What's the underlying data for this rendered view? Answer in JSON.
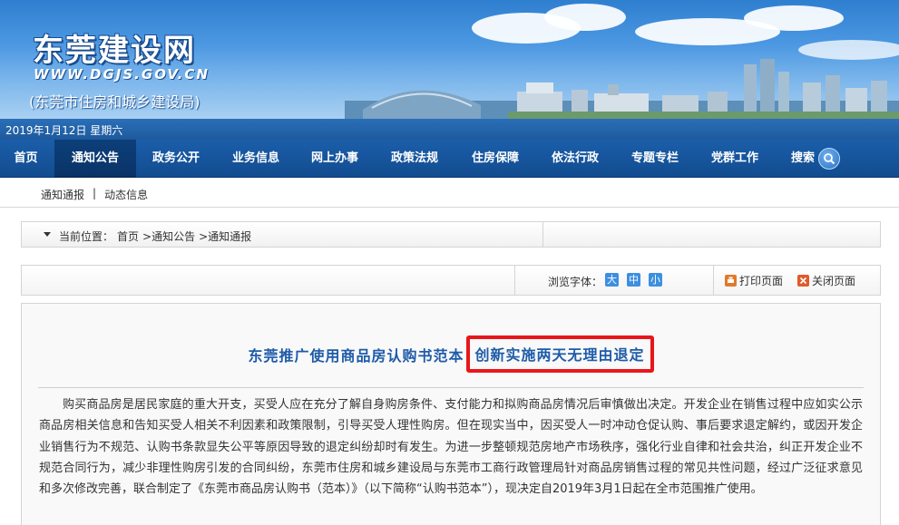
{
  "header": {
    "site_title": "东莞建设网",
    "site_url": "WWW.DGJS.GOV.CN",
    "site_sub": "(东莞市住房和城乡建设局)",
    "date": "2019年1月12日  星期六"
  },
  "nav": {
    "items": [
      {
        "label": "首页"
      },
      {
        "label": "通知公告"
      },
      {
        "label": "政务公开"
      },
      {
        "label": "业务信息"
      },
      {
        "label": "网上办事"
      },
      {
        "label": "政策法规"
      },
      {
        "label": "住房保障"
      },
      {
        "label": "依法行政"
      },
      {
        "label": "专题专栏"
      },
      {
        "label": "党群工作"
      }
    ],
    "search_label": "搜索",
    "active": "通知公告"
  },
  "subnav": {
    "items": [
      "通知通报",
      "动态信息"
    ],
    "separator": "|"
  },
  "breadcrumb": {
    "label": "当前位置：",
    "items": [
      "首页",
      ">通知公告",
      ">通知通报"
    ]
  },
  "tools": {
    "font_label": "浏览字体：",
    "font_large": "大",
    "font_medium": "中",
    "font_small": "小",
    "print_label": "打印页面",
    "close_label": "关闭页面"
  },
  "article": {
    "title_part1": "东莞推广使用商品房认购书范本",
    "title_part2": "创新实施两天无理由退定",
    "highlight_color": "#e8161b",
    "body": "购买商品房是居民家庭的重大开支，买受人应在充分了解自身购房条件、支付能力和拟购商品房情况后审慎做出决定。开发企业在销售过程中应如实公示商品房相关信息和告知买受人相关不利因素和政策限制，引导买受人理性购房。但在现实当中，因买受人一时冲动仓促认购、事后要求退定解约，或因开发企业销售行为不规范、认购书条款显失公平等原因导致的退定纠纷却时有发生。为进一步整顿规范房地产市场秩序，强化行业自律和社会共治，纠正开发企业不规范合同行为，减少非理性购房引发的合同纠纷，东莞市住房和城乡建设局与东莞市工商行政管理局针对商品房销售过程的常见共性问题，经过广泛征求意见和多次修改完善，联合制定了《东莞市商品房认购书（范本）》（以下简称“认购书范本”），现决定自2019年3月1日起在全市范围推广使用。"
  }
}
